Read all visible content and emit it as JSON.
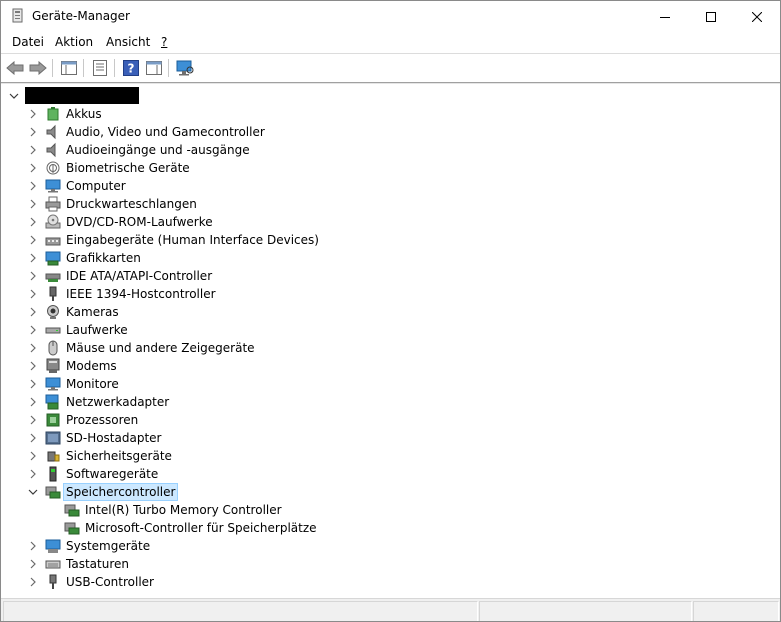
{
  "window": {
    "title": "Geräte-Manager"
  },
  "menu": {
    "datei": "Datei",
    "aktion": "Aktion",
    "ansicht": "Ansicht",
    "hilfe": "?"
  },
  "tree": {
    "categories": [
      {
        "label": "Akkus",
        "icon": "battery-icon"
      },
      {
        "label": "Audio, Video und Gamecontroller",
        "icon": "speaker-icon"
      },
      {
        "label": "Audioeingänge und -ausgänge",
        "icon": "speaker-icon"
      },
      {
        "label": "Biometrische Geräte",
        "icon": "fingerprint-icon"
      },
      {
        "label": "Computer",
        "icon": "computer-icon"
      },
      {
        "label": "Druckwarteschlangen",
        "icon": "printer-icon"
      },
      {
        "label": "DVD/CD-ROM-Laufwerke",
        "icon": "dvd-drive-icon"
      },
      {
        "label": "Eingabegeräte (Human Interface Devices)",
        "icon": "hid-icon"
      },
      {
        "label": "Grafikkarten",
        "icon": "display-adapter-icon"
      },
      {
        "label": "IDE ATA/ATAPI-Controller",
        "icon": "ide-controller-icon"
      },
      {
        "label": "IEEE 1394-Hostcontroller",
        "icon": "firewire-icon"
      },
      {
        "label": "Kameras",
        "icon": "camera-icon"
      },
      {
        "label": "Laufwerke",
        "icon": "disk-drive-icon"
      },
      {
        "label": "Mäuse und andere Zeigegeräte",
        "icon": "mouse-icon"
      },
      {
        "label": "Modems",
        "icon": "modem-icon"
      },
      {
        "label": "Monitore",
        "icon": "monitor-icon"
      },
      {
        "label": "Netzwerkadapter",
        "icon": "network-adapter-icon"
      },
      {
        "label": "Prozessoren",
        "icon": "processor-icon"
      },
      {
        "label": "SD-Hostadapter",
        "icon": "sd-host-icon"
      },
      {
        "label": "Sicherheitsgeräte",
        "icon": "security-device-icon"
      },
      {
        "label": "Softwaregeräte",
        "icon": "software-device-icon"
      },
      {
        "label": "Speichercontroller",
        "icon": "storage-controller-icon"
      },
      {
        "label": "Systemgeräte",
        "icon": "system-device-icon"
      },
      {
        "label": "Tastaturen",
        "icon": "keyboard-icon"
      },
      {
        "label": "USB-Controller",
        "icon": "usb-icon"
      }
    ],
    "expanded_children": [
      {
        "label": "Intel(R) Turbo Memory Controller",
        "icon": "storage-controller-icon"
      },
      {
        "label": "Microsoft-Controller für Speicherplätze",
        "icon": "storage-controller-icon"
      }
    ]
  },
  "colors": {
    "selection_bg": "#cce8ff",
    "selection_border": "#99d1ff"
  }
}
